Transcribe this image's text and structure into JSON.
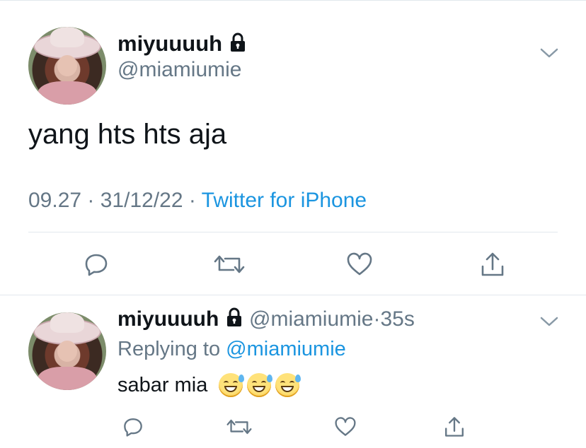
{
  "main_tweet": {
    "display_name": "miyuuuuh",
    "handle": "@miamiumie",
    "text": "yang hts hts aja",
    "time": "09.27",
    "date": "31/12/22",
    "source": "Twitter for iPhone",
    "separator": "·"
  },
  "reply_tweet": {
    "display_name": "miyuuuuh",
    "handle": "@miamiumie",
    "dot": "·",
    "age": "35s",
    "replying_prefix": "Replying to",
    "replying_handle": "@miamiumie",
    "text": "sabar mia",
    "emoji_count": 3
  },
  "icons": {
    "lock": "lock-icon",
    "chevron": "chevron-down-icon",
    "reply": "reply-icon",
    "retweet": "retweet-icon",
    "like": "heart-icon",
    "share": "share-icon"
  },
  "colors": {
    "link": "#1b95e0",
    "secondary_text": "#657786",
    "primary_text": "#0f1419",
    "divider": "#e1e8ed"
  }
}
